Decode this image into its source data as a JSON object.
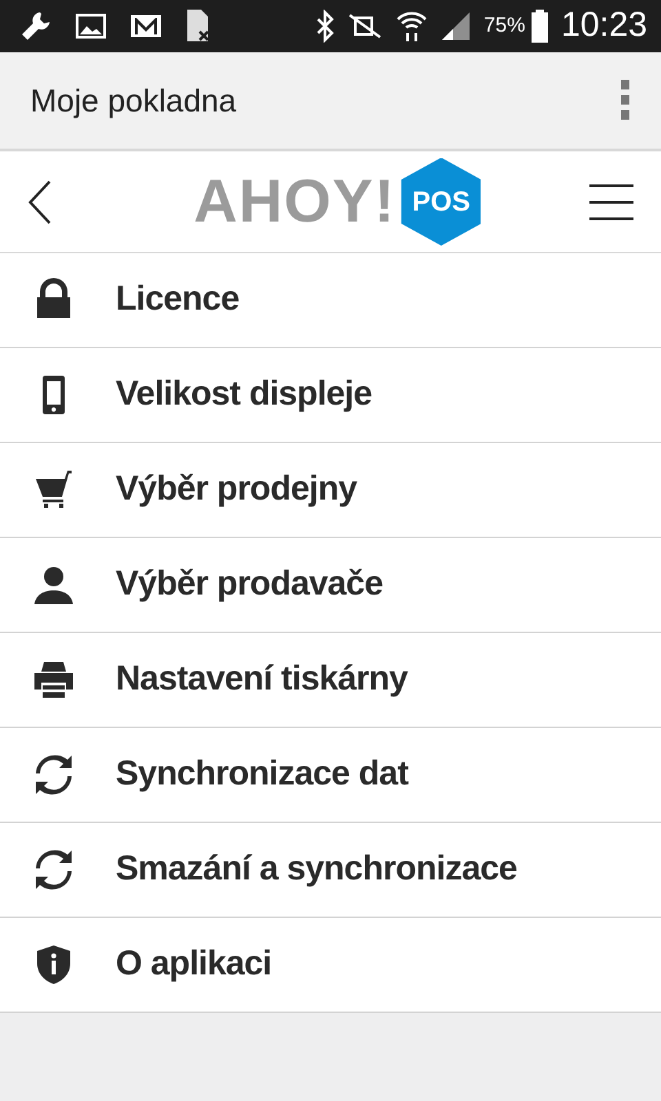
{
  "status_bar": {
    "battery": "75%",
    "time": "10:23"
  },
  "app_bar": {
    "title": "Moje pokladna"
  },
  "header": {
    "logo_text": "AHOY!",
    "logo_badge": "POS"
  },
  "menu": [
    {
      "kind": "lock",
      "label": "Licence"
    },
    {
      "kind": "phone",
      "label": "Velikost displeje"
    },
    {
      "kind": "cart",
      "label": "Výběr prodejny"
    },
    {
      "kind": "user",
      "label": "Výběr prodavače"
    },
    {
      "kind": "printer",
      "label": "Nastavení tiskárny"
    },
    {
      "kind": "sync",
      "label": "Synchronizace dat"
    },
    {
      "kind": "sync",
      "label": "Smazání a synchronizace"
    },
    {
      "kind": "shield",
      "label": "O aplikaci"
    }
  ]
}
